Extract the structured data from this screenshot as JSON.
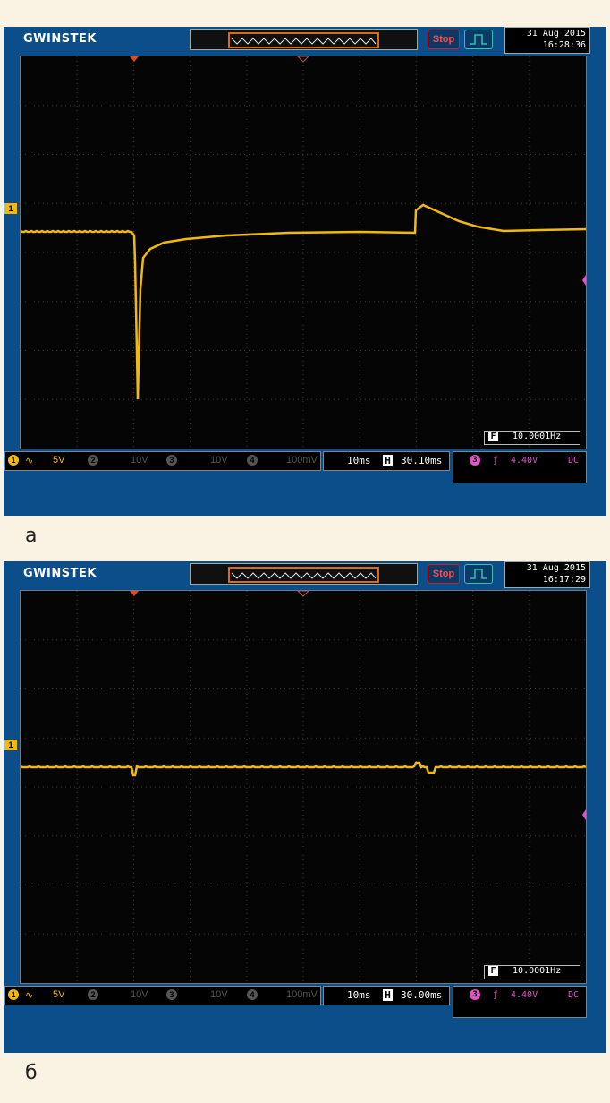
{
  "scopes": [
    {
      "id": "a",
      "brand": "GWINSTEK",
      "run_state": "Stop",
      "date": "31 Aug 2015",
      "time": "16:28:36",
      "ch1": {
        "marker": "1",
        "coupling_symbol": "∿",
        "scale": "5V"
      },
      "ch2": {
        "marker": "2",
        "scale": "10V"
      },
      "ch3": {
        "marker": "3",
        "scale": "10V"
      },
      "ch4": {
        "marker": "4",
        "scale": "100mV"
      },
      "timebase": "10ms",
      "h_label": "H",
      "h_position": "30.10ms",
      "trigger": {
        "source": "3",
        "slope": "ƒ",
        "level": "4.40V",
        "coupling": "DC"
      },
      "freq_label": "F",
      "frequency": "10.0001Hz",
      "caption": "а"
    },
    {
      "id": "b",
      "brand": "GWINSTEK",
      "run_state": "Stop",
      "date": "31 Aug 2015",
      "time": "16:17:29",
      "ch1": {
        "marker": "1",
        "coupling_symbol": "∿",
        "scale": "5V"
      },
      "ch2": {
        "marker": "2",
        "scale": "10V"
      },
      "ch3": {
        "marker": "3",
        "scale": "10V"
      },
      "ch4": {
        "marker": "4",
        "scale": "100mV"
      },
      "timebase": "10ms",
      "h_label": "H",
      "h_position": "30.00ms",
      "trigger": {
        "source": "3",
        "slope": "ƒ",
        "level": "4.40V",
        "coupling": "DC"
      },
      "freq_label": "F",
      "frequency": "10.0001Hz",
      "caption": "б"
    }
  ],
  "colors": {
    "trace": "#f2b90d",
    "trigger": "#e054c8",
    "frame": "#0b4e8a",
    "marker": "#e24a1c"
  }
}
